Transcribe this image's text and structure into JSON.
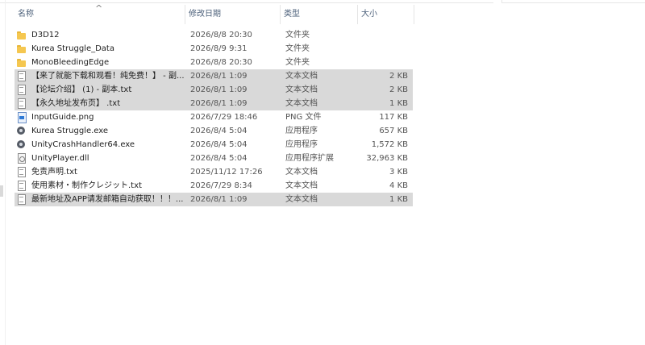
{
  "columns": {
    "name": "名称",
    "date": "修改日期",
    "type": "类型",
    "size": "大小",
    "sort_indicator": "^"
  },
  "files": [
    {
      "icon": "folder-icon",
      "name": "D3D12",
      "date": "2026/8/8 20:30",
      "type": "文件夹",
      "size": "",
      "selected": false
    },
    {
      "icon": "folder-icon",
      "name": "Kurea Struggle_Data",
      "date": "2026/8/9 9:31",
      "type": "文件夹",
      "size": "",
      "selected": false
    },
    {
      "icon": "folder-icon",
      "name": "MonoBleedingEdge",
      "date": "2026/8/8 20:30",
      "type": "文件夹",
      "size": "",
      "selected": false
    },
    {
      "icon": "text-file-icon",
      "name": "【来了就能下载和观看！纯免费！】 - 副...",
      "date": "2026/8/1 1:09",
      "type": "文本文档",
      "size": "2 KB",
      "selected": true
    },
    {
      "icon": "text-file-icon",
      "name": "【论坛介绍】 (1) - 副本.txt",
      "date": "2026/8/1 1:09",
      "type": "文本文档",
      "size": "2 KB",
      "selected": true
    },
    {
      "icon": "text-file-icon",
      "name": "【永久地址发布页】 .txt",
      "date": "2026/8/1 1:09",
      "type": "文本文档",
      "size": "1 KB",
      "selected": true
    },
    {
      "icon": "image-file-icon",
      "name": "InputGuide.png",
      "date": "2026/7/29 18:46",
      "type": "PNG 文件",
      "size": "117 KB",
      "selected": false
    },
    {
      "icon": "application-icon",
      "name": "Kurea Struggle.exe",
      "date": "2026/8/4 5:04",
      "type": "应用程序",
      "size": "657 KB",
      "selected": false
    },
    {
      "icon": "application-icon",
      "name": "UnityCrashHandler64.exe",
      "date": "2026/8/4 5:04",
      "type": "应用程序",
      "size": "1,572 KB",
      "selected": false
    },
    {
      "icon": "dll-file-icon",
      "name": "UnityPlayer.dll",
      "date": "2026/8/4 5:04",
      "type": "应用程序扩展",
      "size": "32,963 KB",
      "selected": false
    },
    {
      "icon": "text-file-icon",
      "name": "免责声明.txt",
      "date": "2025/11/12 17:26",
      "type": "文本文档",
      "size": "3 KB",
      "selected": false
    },
    {
      "icon": "text-file-icon",
      "name": "使用素材・制作クレジット.txt",
      "date": "2026/7/29 8:34",
      "type": "文本文档",
      "size": "4 KB",
      "selected": false
    },
    {
      "icon": "text-file-icon",
      "name": "最新地址及APP请发邮箱自动获取！！！...",
      "date": "2026/8/1 1:09",
      "type": "文本文档",
      "size": "1 KB",
      "selected": true
    }
  ],
  "colors": {
    "selected_row": "#d9d9d9",
    "header_text": "#4c607a",
    "folder": "#f5c750"
  }
}
